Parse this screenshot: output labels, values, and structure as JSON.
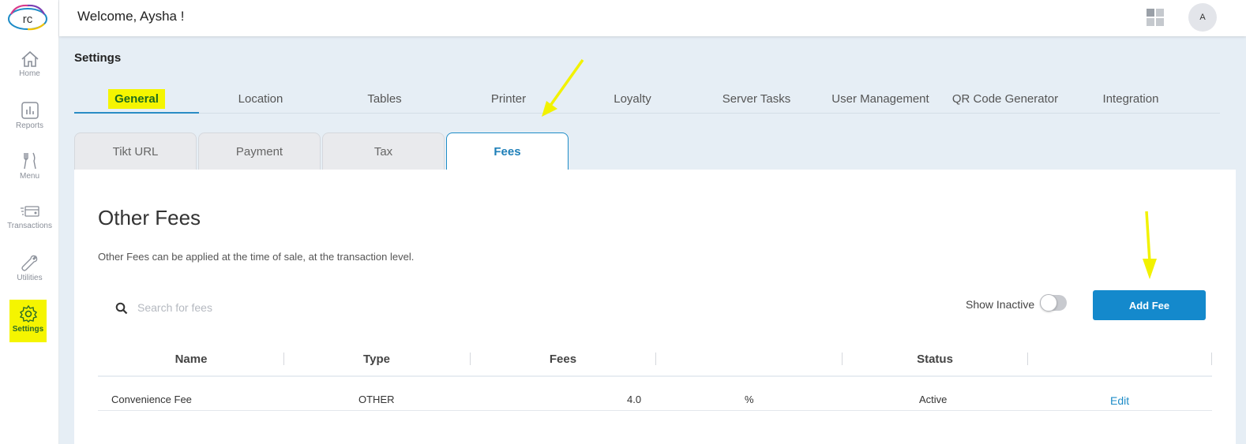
{
  "header": {
    "welcome": "Welcome, Aysha !",
    "avatar_initial": "A"
  },
  "sidebar": {
    "logo_text": "rc",
    "items": [
      {
        "label": "Home",
        "icon": "home-icon"
      },
      {
        "label": "Reports",
        "icon": "bar-chart-icon"
      },
      {
        "label": "Menu",
        "icon": "fork-knife-icon"
      },
      {
        "label": "Transactions",
        "icon": "card-icon"
      },
      {
        "label": "Utilities",
        "icon": "wrench-icon"
      },
      {
        "label": "Settings",
        "icon": "gear-icon",
        "active": true
      }
    ]
  },
  "page": {
    "title": "Settings",
    "top_tabs": [
      "General",
      "Location",
      "Tables",
      "Printer",
      "Loyalty",
      "Server Tasks",
      "User Management",
      "QR Code Generator",
      "Integration"
    ],
    "active_top_tab": "General",
    "sub_tabs": [
      "Tikt URL",
      "Payment",
      "Tax",
      "Fees"
    ],
    "active_sub_tab": "Fees"
  },
  "fees": {
    "title": "Other Fees",
    "description": "Other Fees can be applied at the time of sale, at the transaction level.",
    "search_placeholder": "Search for fees",
    "show_inactive_label": "Show Inactive",
    "show_inactive": false,
    "add_button": "Add Fee",
    "columns": [
      "Name",
      "Type",
      "Fees",
      "",
      "Status",
      ""
    ],
    "rows": [
      {
        "name": "Convenience Fee",
        "type": "OTHER",
        "fee": "4.0",
        "unit": "%",
        "status": "Active",
        "action": "Edit"
      }
    ]
  },
  "colors": {
    "accent": "#1489cc",
    "highlight": "#f5f500",
    "main_bg": "#e6eef5"
  }
}
